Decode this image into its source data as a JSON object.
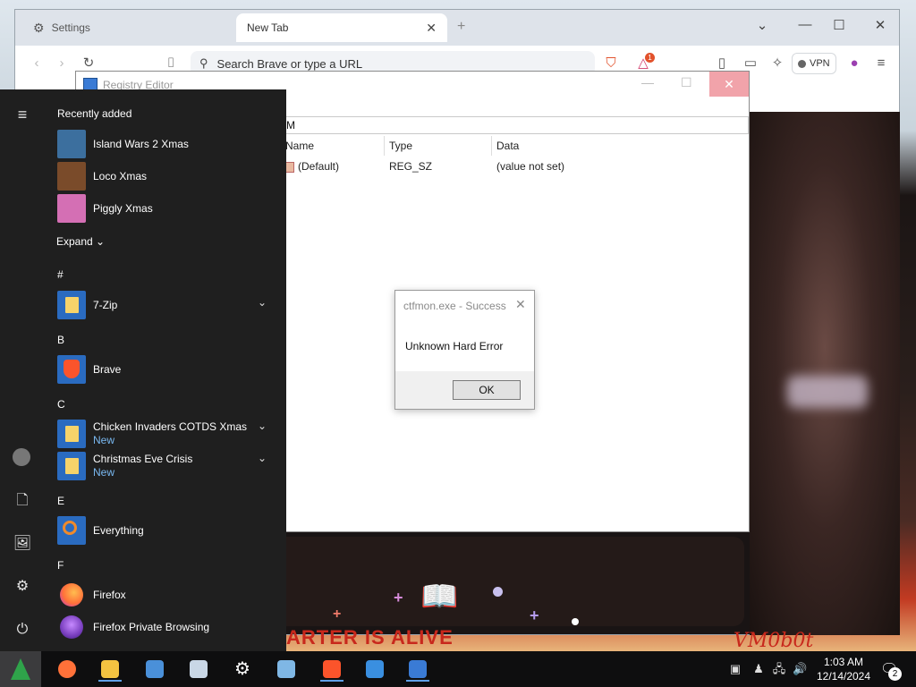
{
  "browser": {
    "tabs": [
      {
        "label": "Settings",
        "icon": "gear-icon"
      },
      {
        "label": "New Tab",
        "icon": "close-icon"
      }
    ],
    "url_placeholder": "Search Brave or type a URL",
    "vpn_label": "VPN",
    "shields_badge": "1",
    "ntp_banner": "ARTER IS ALIVE",
    "ntp_signature": "VM0b0t"
  },
  "regedit": {
    "title": "Registry Editor",
    "address": "M",
    "columns": [
      "Name",
      "Type",
      "Data"
    ],
    "rows": [
      {
        "name": "(Default)",
        "type": "REG_SZ",
        "data": "(value not set)"
      }
    ]
  },
  "msgbox": {
    "title": "ctfmon.exe - Success",
    "message": "Unknown Hard Error",
    "ok_label": "OK"
  },
  "startmenu": {
    "recent_header": "Recently added",
    "recent": [
      {
        "label": "Island Wars 2 Xmas",
        "color": "#3c6f9e"
      },
      {
        "label": "Loco Xmas",
        "color": "#7a4b2a"
      },
      {
        "label": "Piggly Xmas",
        "color": "#d46fb4"
      }
    ],
    "expand_label": "Expand",
    "groups": [
      {
        "letter": "#",
        "items": [
          {
            "label": "7-Zip",
            "kind": "folder",
            "has_chevron": true
          }
        ]
      },
      {
        "letter": "B",
        "items": [
          {
            "label": "Brave",
            "kind": "app",
            "color": "#fb542b"
          }
        ]
      },
      {
        "letter": "C",
        "items": [
          {
            "label": "Chicken Invaders COTDS Xmas",
            "kind": "folder",
            "new": "New",
            "has_chevron": true
          },
          {
            "label": "Christmas Eve Crisis",
            "kind": "folder",
            "new": "New",
            "has_chevron": true
          }
        ]
      },
      {
        "letter": "E",
        "items": [
          {
            "label": "Everything",
            "kind": "app",
            "color": "#2d6fc8"
          }
        ]
      },
      {
        "letter": "F",
        "items": [
          {
            "label": "Firefox",
            "kind": "app",
            "color": "#ff7139"
          },
          {
            "label": "Firefox Private Browsing",
            "kind": "app",
            "color": "#7a3fbf"
          }
        ]
      }
    ]
  },
  "taskbar": {
    "apps": [
      {
        "name": "firefox",
        "color": "#ff7139"
      },
      {
        "name": "file-explorer",
        "color": "#f3c341"
      },
      {
        "name": "people",
        "color": "#4a90d9"
      },
      {
        "name": "notepad",
        "color": "#c9d7e6"
      },
      {
        "name": "settings",
        "color": "#ffffff"
      },
      {
        "name": "notes",
        "color": "#7fb7e5"
      },
      {
        "name": "brave",
        "color": "#fb542b"
      },
      {
        "name": "network-app",
        "color": "#3a8fe0"
      },
      {
        "name": "registry-editor",
        "color": "#3a7bd5"
      }
    ],
    "time": "1:03 AM",
    "date": "12/14/2024",
    "notification_count": "2"
  }
}
